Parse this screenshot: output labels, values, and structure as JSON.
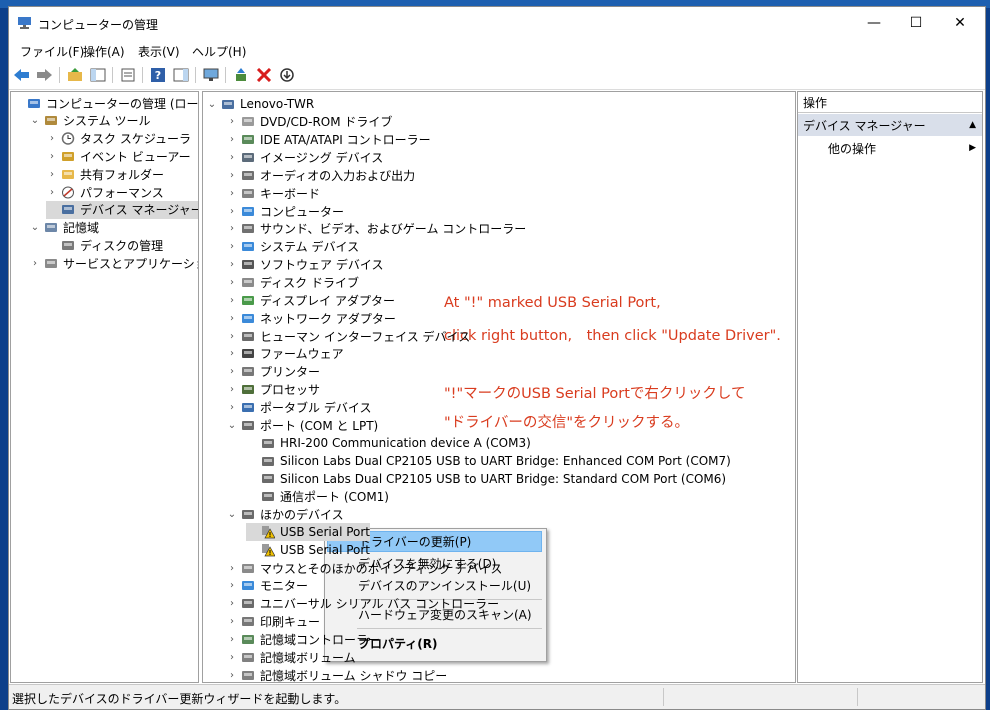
{
  "window": {
    "title": "コンピューターの管理",
    "minimize": "—",
    "maximize": "☐",
    "close": "✕"
  },
  "menu": [
    "ファイル(F)",
    "操作(A)",
    "表示(V)",
    "ヘルプ(H)"
  ],
  "toolbar": [
    "back-icon",
    "forward-icon",
    "up-folder-icon",
    "show-tree-icon",
    "export-list-icon",
    "help-icon",
    "show-action-pane-icon",
    "monitor-icon",
    "update-driver-icon",
    "uninstall-icon",
    "download-icon"
  ],
  "left_tree": [
    {
      "label": "コンピューターの管理 (ローカル)",
      "arrow": "",
      "icon": "computer-manage-icon"
    },
    {
      "label": "システム ツール",
      "arrow": "⌄",
      "icon": "tools-icon"
    },
    {
      "label": "タスク スケジューラ",
      "arrow": "›",
      "icon": "clock-icon"
    },
    {
      "label": "イベント ビューアー",
      "arrow": "›",
      "icon": "event-viewer-icon"
    },
    {
      "label": "共有フォルダー",
      "arrow": "›",
      "icon": "shared-folder-icon"
    },
    {
      "label": "パフォーマンス",
      "arrow": "›",
      "icon": "performance-icon"
    },
    {
      "label": "デバイス マネージャー",
      "arrow": "",
      "icon": "device-manager-icon"
    },
    {
      "label": "記憶域",
      "arrow": "⌄",
      "icon": "storage-icon"
    },
    {
      "label": "ディスクの管理",
      "arrow": "",
      "icon": "disk-manage-icon"
    },
    {
      "label": "サービスとアプリケーション",
      "arrow": "›",
      "icon": "services-icon"
    }
  ],
  "device_tree": [
    {
      "label": "Lenovo-TWR",
      "arrow": "⌄",
      "icon": "pc-icon"
    },
    {
      "label": "DVD/CD-ROM ドライブ",
      "arrow": "›",
      "icon": "dvd-icon"
    },
    {
      "label": "IDE ATA/ATAPI コントローラー",
      "arrow": "›",
      "icon": "ide-icon"
    },
    {
      "label": "イメージング デバイス",
      "arrow": "›",
      "icon": "camera-icon"
    },
    {
      "label": "オーディオの入力および出力",
      "arrow": "›",
      "icon": "speaker-icon"
    },
    {
      "label": "キーボード",
      "arrow": "›",
      "icon": "keyboard-icon"
    },
    {
      "label": "コンピューター",
      "arrow": "›",
      "icon": "computer-icon"
    },
    {
      "label": "サウンド、ビデオ、およびゲーム コントローラー",
      "arrow": "›",
      "icon": "sound-icon"
    },
    {
      "label": "システム デバイス",
      "arrow": "›",
      "icon": "system-folder-icon"
    },
    {
      "label": "ソフトウェア デバイス",
      "arrow": "›",
      "icon": "software-device-icon"
    },
    {
      "label": "ディスク ドライブ",
      "arrow": "›",
      "icon": "disk-drive-icon"
    },
    {
      "label": "ディスプレイ アダプター",
      "arrow": "›",
      "icon": "display-adapter-icon"
    },
    {
      "label": "ネットワーク アダプター",
      "arrow": "›",
      "icon": "network-adapter-icon"
    },
    {
      "label": "ヒューマン インターフェイス デバイス",
      "arrow": "›",
      "icon": "hid-icon"
    },
    {
      "label": "ファームウェア",
      "arrow": "›",
      "icon": "firmware-icon"
    },
    {
      "label": "プリンター",
      "arrow": "›",
      "icon": "printer-icon"
    },
    {
      "label": "プロセッサ",
      "arrow": "›",
      "icon": "processor-icon"
    },
    {
      "label": "ポータブル デバイス",
      "arrow": "›",
      "icon": "portable-device-icon"
    },
    {
      "label": "ポート (COM と LPT)",
      "arrow": "⌄",
      "icon": "port-icon"
    },
    {
      "label": "HRI-200 Communication device A (COM3)",
      "arrow": "",
      "icon": "port-device-icon"
    },
    {
      "label": "Silicon Labs Dual CP2105 USB to UART Bridge: Enhanced COM Port (COM7)",
      "arrow": "",
      "icon": "port-device-icon"
    },
    {
      "label": "Silicon Labs Dual CP2105 USB to UART Bridge: Standard COM Port (COM6)",
      "arrow": "",
      "icon": "port-device-icon"
    },
    {
      "label": "通信ポート (COM1)",
      "arrow": "",
      "icon": "port-device-icon"
    },
    {
      "label": "ほかのデバイス",
      "arrow": "⌄",
      "icon": "other-devices-icon"
    },
    {
      "label": "USB Serial Port",
      "arrow": "",
      "icon": "warning-device-icon"
    },
    {
      "label": "USB Serial Port",
      "arrow": "",
      "icon": "warning-device-icon"
    },
    {
      "label": "マウスとそのほかのポインティング デバイス",
      "arrow": "›",
      "icon": "mouse-icon"
    },
    {
      "label": "モニター",
      "arrow": "›",
      "icon": "monitor-icon"
    },
    {
      "label": "ユニバーサル シリアル バス コントローラー",
      "arrow": "›",
      "icon": "usb-icon"
    },
    {
      "label": "印刷キュー",
      "arrow": "›",
      "icon": "print-queue-icon"
    },
    {
      "label": "記憶域コントローラー",
      "arrow": "›",
      "icon": "storage-controller-icon"
    },
    {
      "label": "記憶域ボリューム",
      "arrow": "›",
      "icon": "storage-volume-icon"
    },
    {
      "label": "記憶域ボリューム シャドウ コピー",
      "arrow": "›",
      "icon": "shadow-copy-icon"
    }
  ],
  "context_menu": [
    "ドライバーの更新(P)",
    "デバイスを無効にする(D)",
    "デバイスのアンインストール(U)",
    "ハードウェア変更のスキャン(A)",
    "プロパティ(R)"
  ],
  "annotations": [
    "At \"!\" marked USB Serial Port,",
    "click right button,　then click \"Update Driver\".",
    "\"!\"マークのUSB Serial Portで右クリックして",
    "\"ドライバーの交信\"をクリックする。"
  ],
  "action_pane": {
    "header": "操作",
    "section": "デバイス マネージャー",
    "section_arrow": "▲",
    "item": "他の操作",
    "item_arrow": "▶"
  },
  "status": "選択したデバイスのドライバー更新ウィザードを起動します。",
  "colors": {
    "annotation": "#d93c1f",
    "selection": "#91c9f7",
    "action_section": "#d9dfea"
  }
}
